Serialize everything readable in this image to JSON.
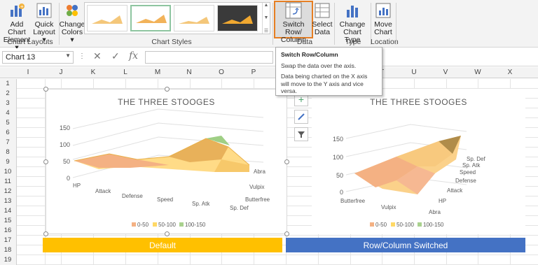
{
  "ribbon": {
    "add_chart_element": {
      "line1": "Add Chart",
      "line2": "Element ▾"
    },
    "quick_layout": {
      "line1": "Quick",
      "line2": "Layout ▾"
    },
    "chart_layouts_label": "Chart Layouts",
    "change_colors": {
      "line1": "Change",
      "line2": "Colors ▾"
    },
    "chart_styles_label": "Chart Styles",
    "switch_row_column": {
      "line1": "Switch Row/",
      "line2": "Column"
    },
    "select_data": {
      "line1": "Select",
      "line2": "Data"
    },
    "data_label": "Data",
    "change_chart_type": {
      "line1": "Change",
      "line2": "Chart Type"
    },
    "type_label": "Type",
    "move_chart": {
      "line1": "Move",
      "line2": "Chart"
    },
    "location_label": "Location"
  },
  "formula_bar": {
    "name_box": "Chart 13",
    "formula": ""
  },
  "tooltip": {
    "title": "Switch Row/Column",
    "line1": "Swap the data over the axis.",
    "line2": "Data being charted on the X axis will move to the Y axis and vice versa."
  },
  "columns": [
    "I",
    "J",
    "K",
    "L",
    "M",
    "N",
    "O",
    "P",
    "Q",
    "R",
    "S",
    "T",
    "U",
    "V",
    "W",
    "X"
  ],
  "rows": [
    "1",
    "2",
    "3",
    "4",
    "5",
    "6",
    "7",
    "8",
    "9",
    "10",
    "11",
    "12",
    "13",
    "14",
    "15",
    "16",
    "17",
    "18",
    "19"
  ],
  "banners": {
    "left": "Default",
    "right": "Row/Column Switched"
  },
  "colors": {
    "accent_orange": "#e67e22",
    "default_banner": "#ffc000",
    "switched_banner": "#4472c4"
  },
  "chart_data": [
    {
      "type": "surface",
      "title": "THE THREE STOOGES",
      "z_ticks": [
        "0",
        "50",
        "100",
        "150"
      ],
      "x_categories": [
        "HP",
        "Attack",
        "Defense",
        "Speed",
        "Sp. Atk",
        "Sp. Def"
      ],
      "y_series": [
        "Abra",
        "Vulpix",
        "Butterfree"
      ],
      "legend": [
        "0-50",
        "50-100",
        "100-150"
      ],
      "legend_colors": [
        "#f4b183",
        "#ffd966",
        "#a9d18e"
      ]
    },
    {
      "type": "surface",
      "title": "THE THREE STOOGES",
      "z_ticks": [
        "0",
        "50",
        "100",
        "150"
      ],
      "x_categories": [
        "Butterfree",
        "Vulpix",
        "Abra"
      ],
      "y_series": [
        "HP",
        "Attack",
        "Defense",
        "Speed",
        "Sp. Atk",
        "Sp. Def"
      ],
      "legend": [
        "0-50",
        "50-100",
        "100-150"
      ],
      "legend_colors": [
        "#f4b183",
        "#ffd966",
        "#a9d18e"
      ]
    }
  ]
}
